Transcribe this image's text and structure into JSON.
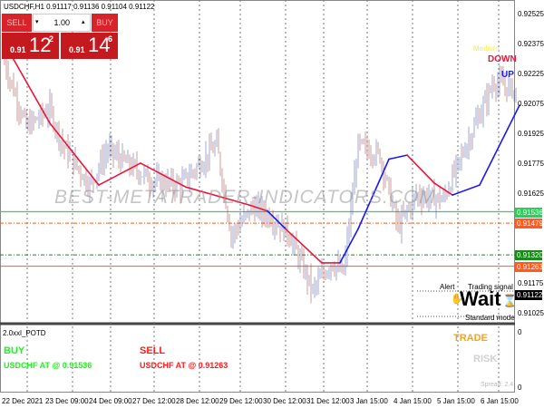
{
  "header": {
    "symbol_line": "USDCHF,H1  0.91117 0.91136 0.91104 0.91122"
  },
  "trade_panel": {
    "sell_label": "SELL",
    "buy_label": "BUY",
    "lot": "1.00",
    "sell_prefix": "0.91",
    "sell_big": "12",
    "sell_sup": "2",
    "buy_prefix": "0.91",
    "buy_big": "14",
    "buy_sup": "6"
  },
  "signals": {
    "medium": "Medium",
    "down": "DOWN",
    "up": "UP",
    "alert": "Alert",
    "trading_signal": "Trading  signal",
    "wait": "Wait",
    "mode": "Standard mode"
  },
  "watermark": "BEST-METATRADER-INDICATORS.COM",
  "price_axis": [
    "0.92525",
    "0.92375",
    "0.92225",
    "0.92075",
    "0.91925",
    "0.91775",
    "0.91625",
    "0.91175",
    "0.91025"
  ],
  "price_levels": [
    {
      "value": "0.91536",
      "color": "#2ecc5a"
    },
    {
      "value": "0.91479",
      "color": "#ff5a1f"
    },
    {
      "value": "0.91320",
      "color": "#1a8a1a"
    },
    {
      "value": "0.91263",
      "color": "#ff5a1f"
    },
    {
      "value": "0.91122",
      "color": "#000000"
    }
  ],
  "subwindow": {
    "title": "2.0xxl_POTD",
    "buy": "BUY",
    "buy_text": "USDCHF AT @ 0.91536",
    "sell": "SELL",
    "sell_text": "USDCHF AT @ 0.91263",
    "trade": "TRADE",
    "risk": "RISK",
    "spread": "Spread: 2.4",
    "axis_top": "0",
    "axis_bottom": "0"
  },
  "time_axis": [
    "22 Dec 2021",
    "23 Dec 09:00",
    "24 Dec 09:00",
    "27 Dec 12:00",
    "28 Dec 12:00",
    "29 Dec 12:00",
    "30 Dec 12:00",
    "31 Dec 12:00",
    "3 Jan 15:00",
    "4 Jan 15:00",
    "5 Jan 15:00",
    "6 Jan 15:00"
  ],
  "chart_data": {
    "type": "ohlc",
    "price_path": [
      [
        0,
        0.9228
      ],
      [
        12,
        0.9196
      ],
      [
        25,
        0.9205
      ],
      [
        32,
        0.9187
      ],
      [
        47,
        0.9167
      ],
      [
        57,
        0.9185
      ],
      [
        67,
        0.9178
      ],
      [
        82,
        0.9169
      ],
      [
        97,
        0.9167
      ],
      [
        117,
        0.9187
      ],
      [
        125,
        0.9142
      ],
      [
        137,
        0.9156
      ],
      [
        147,
        0.9151
      ],
      [
        157,
        0.9142
      ],
      [
        170,
        0.9114
      ],
      [
        180,
        0.9128
      ],
      [
        187,
        0.9123
      ],
      [
        195,
        0.9187
      ],
      [
        207,
        0.9182
      ],
      [
        217,
        0.9146
      ],
      [
        227,
        0.9162
      ],
      [
        242,
        0.916
      ],
      [
        257,
        0.9192
      ],
      [
        270,
        0.9219
      ],
      [
        282,
        0.9214
      ]
    ],
    "ma": [
      [
        0,
        0.9238,
        "r"
      ],
      [
        25,
        0.9198,
        "r"
      ],
      [
        52,
        0.9167,
        "r"
      ],
      [
        75,
        0.9178,
        "r"
      ],
      [
        100,
        0.9166,
        "r"
      ],
      [
        135,
        0.9157,
        "r"
      ],
      [
        145,
        0.9154,
        "b"
      ],
      [
        155,
        0.9145,
        "r"
      ],
      [
        175,
        0.9128,
        "r"
      ],
      [
        185,
        0.9128,
        "b"
      ],
      [
        195,
        0.9145,
        "b"
      ],
      [
        212,
        0.918,
        "b"
      ],
      [
        222,
        0.9182,
        "r"
      ],
      [
        237,
        0.9168,
        "r"
      ],
      [
        247,
        0.9162,
        "b"
      ],
      [
        262,
        0.9167,
        "b"
      ],
      [
        284,
        0.9207,
        "b"
      ]
    ]
  }
}
